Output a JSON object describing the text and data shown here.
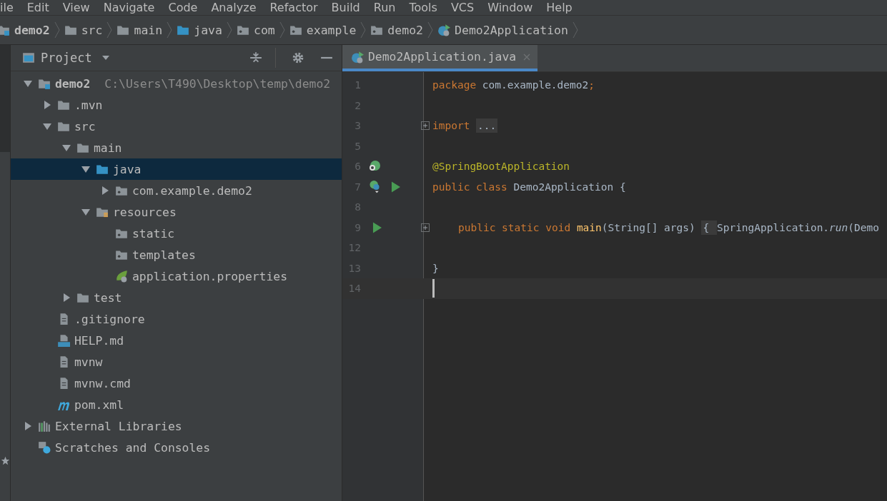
{
  "menu": [
    {
      "label": "ile"
    },
    {
      "label": "Edit"
    },
    {
      "label": "View"
    },
    {
      "label": "Navigate"
    },
    {
      "label": "Code"
    },
    {
      "label": "Analyze"
    },
    {
      "label": "Refactor"
    },
    {
      "label": "Build"
    },
    {
      "label": "Run"
    },
    {
      "label": "Tools"
    },
    {
      "label": "VCS"
    },
    {
      "label": "Window"
    },
    {
      "label": "Help"
    }
  ],
  "breadcrumbs": [
    {
      "label": "demo2",
      "kind": "module"
    },
    {
      "label": "src",
      "kind": "folder"
    },
    {
      "label": "main",
      "kind": "folder"
    },
    {
      "label": "java",
      "kind": "source"
    },
    {
      "label": "com",
      "kind": "package"
    },
    {
      "label": "example",
      "kind": "package"
    },
    {
      "label": "demo2",
      "kind": "package"
    },
    {
      "label": "Demo2Application",
      "kind": "spring-class"
    }
  ],
  "project_panel": {
    "title": "Project"
  },
  "tree": [
    {
      "label": "demo2",
      "path": "C:\\Users\\T490\\Desktop\\temp\\demo2",
      "kind": "module",
      "expanded": true,
      "selected": false,
      "children": [
        {
          "label": ".mvn",
          "kind": "folder",
          "expanded": false,
          "selected": false
        },
        {
          "label": "src",
          "kind": "folder",
          "expanded": true,
          "selected": false,
          "children": [
            {
              "label": "main",
              "kind": "folder",
              "expanded": true,
              "selected": false,
              "children": [
                {
                  "label": "java",
                  "kind": "source",
                  "expanded": true,
                  "selected": true,
                  "children": [
                    {
                      "label": "com.example.demo2",
                      "kind": "package",
                      "expanded": false,
                      "selected": false
                    }
                  ]
                },
                {
                  "label": "resources",
                  "kind": "resources",
                  "expanded": true,
                  "selected": false,
                  "children": [
                    {
                      "label": "static",
                      "kind": "package",
                      "selected": false
                    },
                    {
                      "label": "templates",
                      "kind": "package",
                      "selected": false
                    },
                    {
                      "label": "application.properties",
                      "kind": "spring",
                      "selected": false
                    }
                  ]
                }
              ]
            },
            {
              "label": "test",
              "kind": "folder",
              "expanded": false,
              "selected": false
            }
          ]
        },
        {
          "label": ".gitignore",
          "kind": "file",
          "selected": false
        },
        {
          "label": "HELP.md",
          "kind": "markdown",
          "selected": false
        },
        {
          "label": "mvnw",
          "kind": "file",
          "selected": false
        },
        {
          "label": "mvnw.cmd",
          "kind": "file",
          "selected": false
        },
        {
          "label": "pom.xml",
          "kind": "maven",
          "selected": false
        }
      ]
    },
    {
      "label": "External Libraries",
      "kind": "libraries",
      "expanded": false,
      "selected": false
    },
    {
      "label": "Scratches and Consoles",
      "kind": "scratches",
      "selected": false
    }
  ],
  "editor_tabs": [
    {
      "label": "Demo2Application.java",
      "selected": true
    }
  ],
  "code": [
    {
      "number": "1",
      "tokens": [
        {
          "text": "package ",
          "kind": "keyword"
        },
        {
          "text": "com.example.demo2",
          "kind": "plain"
        },
        {
          "text": ";",
          "kind": "keyword"
        }
      ]
    },
    {
      "number": "2"
    },
    {
      "number": "3",
      "folded": true,
      "tokens": [
        {
          "text": "import ",
          "kind": "keyword"
        },
        {
          "text": "...",
          "kind": "fold"
        }
      ]
    },
    {
      "number": "5"
    },
    {
      "number": "6",
      "markers": [
        {
          "kind": "bean-search"
        }
      ],
      "tokens": [
        {
          "text": "@SpringBootApplication",
          "kind": "annotation"
        }
      ]
    },
    {
      "number": "7",
      "markers": [
        {
          "kind": "bean"
        },
        {
          "kind": "run"
        }
      ],
      "tokens": [
        {
          "text": "public class ",
          "kind": "keyword"
        },
        {
          "text": "Demo2Application {",
          "kind": "plain"
        }
      ]
    },
    {
      "number": "8"
    },
    {
      "number": "9",
      "folded": true,
      "indented": true,
      "markers": [
        {
          "kind": "run"
        }
      ],
      "tokens": [
        {
          "text": "public static void ",
          "kind": "keyword"
        },
        {
          "text": "main",
          "kind": "method"
        },
        {
          "text": "(String[] args) ",
          "kind": "plain"
        },
        {
          "text": "{ ",
          "kind": "fold"
        },
        {
          "text": "SpringApplication.",
          "kind": "plain"
        },
        {
          "text": "run",
          "kind": "static-call"
        },
        {
          "text": "(Demo",
          "kind": "plain"
        }
      ]
    },
    {
      "number": "12"
    },
    {
      "number": "13",
      "tokens": [
        {
          "text": "}",
          "kind": "plain"
        }
      ]
    },
    {
      "number": "14",
      "current": true
    }
  ]
}
